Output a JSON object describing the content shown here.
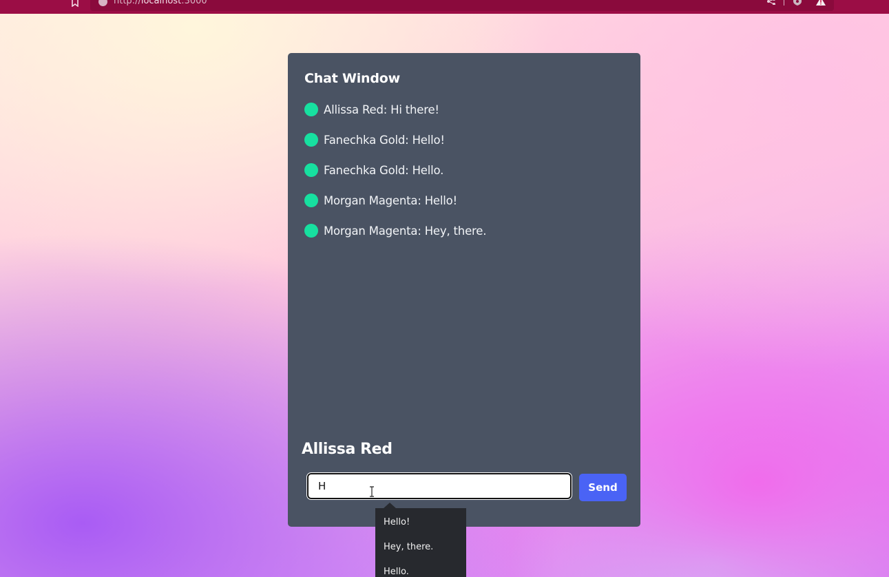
{
  "browser": {
    "url_scheme": "http://",
    "url_host": "localhost",
    "url_port": ":3000"
  },
  "chat": {
    "title": "Chat Window",
    "messages": [
      {
        "text": "Allissa Red: Hi there!"
      },
      {
        "text": "Fanechka Gold: Hello!"
      },
      {
        "text": "Fanechka Gold: Hello."
      },
      {
        "text": "Morgan Magenta: Hello!"
      },
      {
        "text": "Morgan Magenta: Hey, there."
      }
    ],
    "status_color": "#17e0a0",
    "current_user": "Allissa Red",
    "input_value": "H",
    "send_label": "Send",
    "send_color": "#4a63f5"
  },
  "autocomplete": {
    "options": [
      "Hello!",
      "Hey, there.",
      "Hello."
    ]
  },
  "icons": {
    "bookmark": "bookmark-icon",
    "info": "info-icon",
    "share": "share-icon",
    "shield": "shield-icon",
    "alert": "alert-icon",
    "status": "status-dot",
    "cursor": "text-cursor-icon"
  }
}
